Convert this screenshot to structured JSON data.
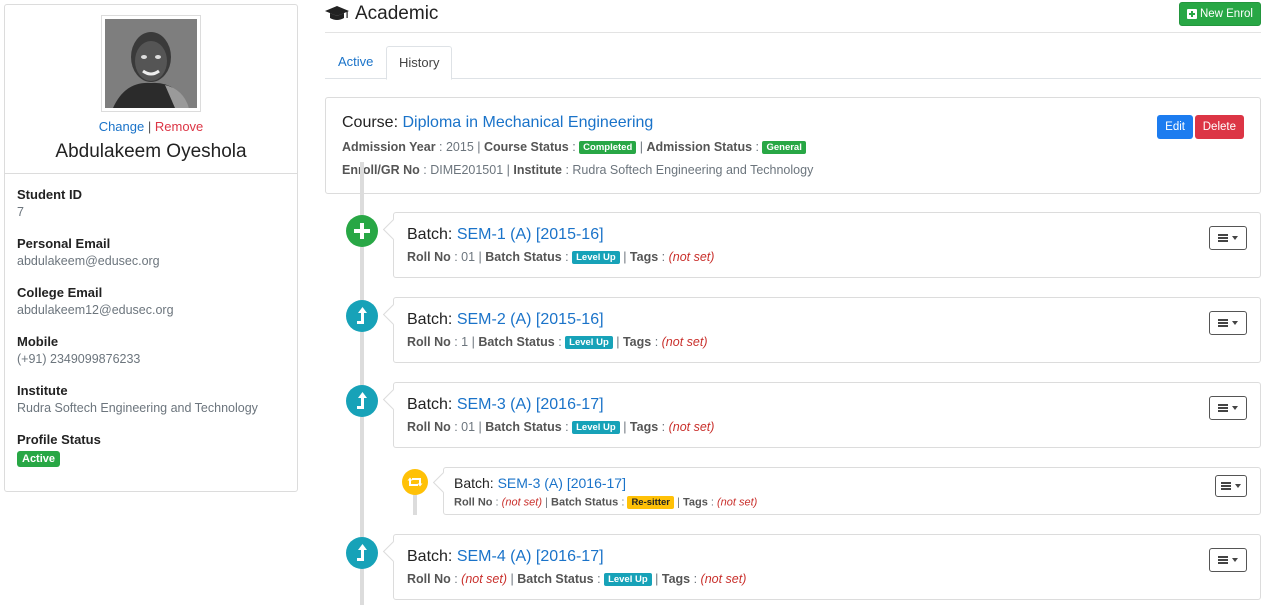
{
  "profile": {
    "change_label": "Change",
    "separator": "|",
    "remove_label": "Remove",
    "name": "Abdulakeem Oyeshola",
    "fields": [
      {
        "label": "Student ID",
        "value": "7"
      },
      {
        "label": "Personal Email",
        "value": "abdulakeem@edusec.org"
      },
      {
        "label": "College Email",
        "value": "abdulakeem12@edusec.org"
      },
      {
        "label": "Mobile",
        "value": "(+91) 2349099876233"
      },
      {
        "label": "Institute",
        "value": "Rudra Softech Engineering and Technology"
      }
    ],
    "status_label": "Profile Status",
    "status_value": "Active"
  },
  "header": {
    "title": "Academic",
    "new_enrol_label": "New Enrol"
  },
  "tabs": [
    {
      "label": "Active",
      "active": false
    },
    {
      "label": "History",
      "active": true
    }
  ],
  "course": {
    "prefix": "Course:",
    "name": "Diploma in Mechanical Engineering",
    "admission_year_label": "Admission Year",
    "admission_year": "2015",
    "course_status_label": "Course Status",
    "course_status": "Completed",
    "admission_status_label": "Admission Status",
    "admission_status": "General",
    "enroll_label": "Enroll/GR No",
    "enroll_no": "DIME201501",
    "institute_label": "Institute",
    "institute": "Rudra Softech Engineering and Technology",
    "edit_label": "Edit",
    "delete_label": "Delete"
  },
  "batch_labels": {
    "prefix": "Batch:",
    "roll_label": "Roll No",
    "status_label": "Batch Status",
    "tags_label": "Tags"
  },
  "batches": [
    {
      "name": "SEM-1 (A) [2015-16]",
      "roll": "01",
      "status": "Level Up",
      "tags": "(not set)",
      "icon": "plus-icon"
    },
    {
      "name": "SEM-2 (A) [2015-16]",
      "roll": "1",
      "status": "Level Up",
      "tags": "(not set)",
      "icon": "level-up-icon"
    },
    {
      "name": "SEM-3 (A) [2016-17]",
      "roll": "01",
      "status": "Level Up",
      "tags": "(not set)",
      "icon": "level-up-icon"
    },
    {
      "name": "SEM-3 (A) [2016-17]",
      "roll": "(not set)",
      "status": "Re-sitter",
      "tags": "(not set)",
      "icon": "retweet-icon"
    },
    {
      "name": "SEM-4 (A) [2016-17]",
      "roll": "(not set)",
      "status": "Level Up",
      "tags": "(not set)",
      "icon": "level-up-icon"
    }
  ],
  "colors": {
    "primary_link": "#1a73c9",
    "success": "#28a745",
    "info": "#17a2b8",
    "warning": "#ffc107",
    "danger": "#dc3545"
  }
}
